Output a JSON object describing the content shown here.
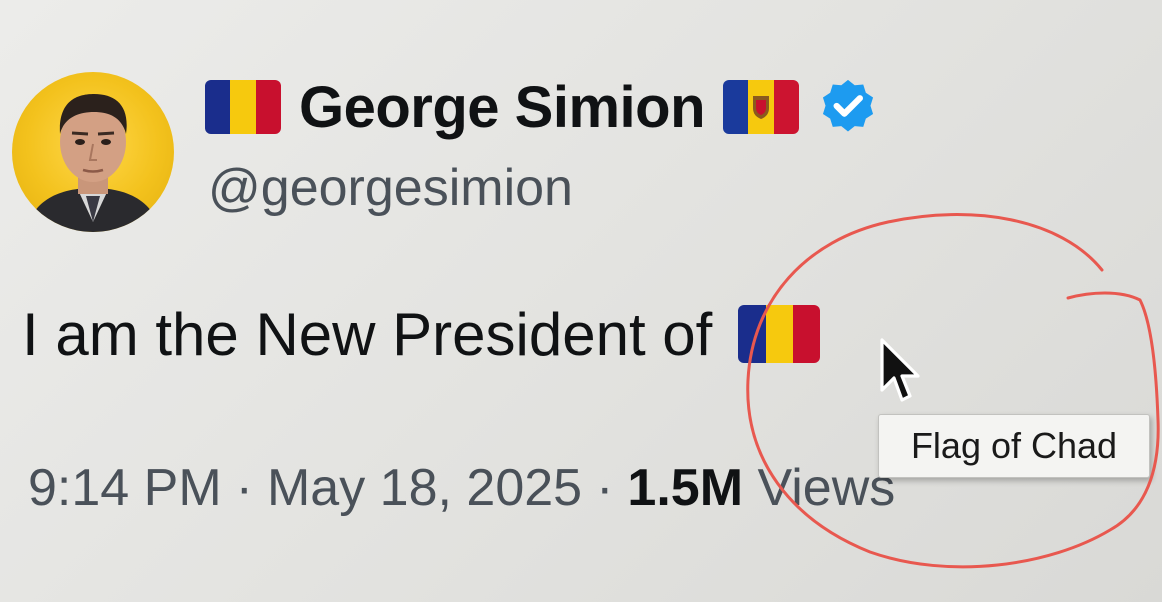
{
  "profile": {
    "display_name": "George Simion",
    "handle": "@georgesimion",
    "verified": true,
    "avatar_icon": "profile-photo"
  },
  "flags": {
    "romania": {
      "name": "Romania",
      "colors": [
        "#1a2d8c",
        "#f6c90e",
        "#c8102e"
      ]
    },
    "moldova": {
      "name": "Moldova",
      "colors": [
        "#1a3a9c",
        "#f6c90e",
        "#cc1430"
      ]
    },
    "tweet_flag": {
      "name": "Chad",
      "colors": [
        "#1a2d8c",
        "#f6c90e",
        "#c8102e"
      ]
    }
  },
  "tweet": {
    "text": "I am the New President of"
  },
  "meta": {
    "time": "9:14 PM",
    "separator": "·",
    "date": "May 18, 2025",
    "views_count": "1.5M",
    "views_label": "Views"
  },
  "tooltip": {
    "text": "Flag of Chad"
  },
  "colors": {
    "verified_badge": "#1d9bf0",
    "annotation_circle": "#e8584f",
    "secondary_text": "#4a5159"
  }
}
